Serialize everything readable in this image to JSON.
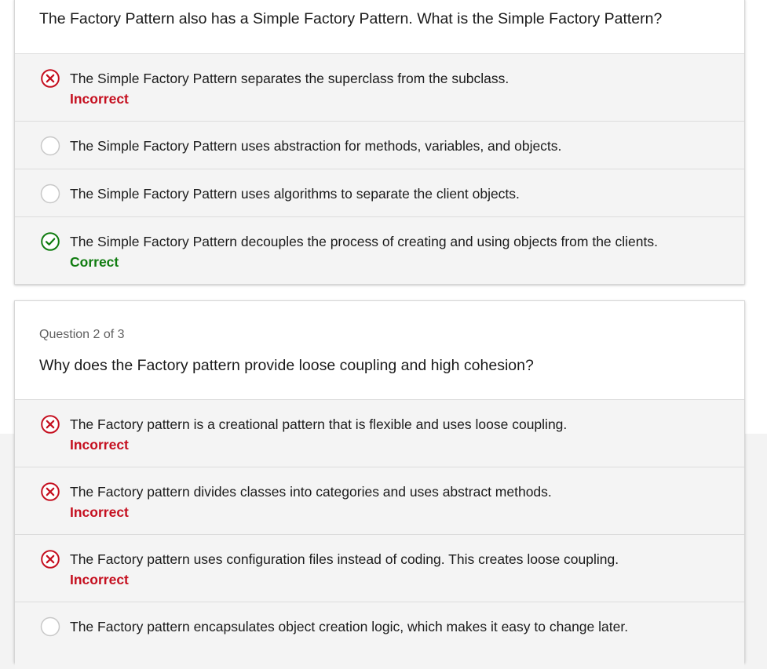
{
  "colors": {
    "incorrect": "#c50f1f",
    "correct": "#107c10",
    "radio_border": "#c8c8c8",
    "option_bg": "#f4f4f4"
  },
  "question1": {
    "text": "The Factory Pattern also has a Simple Factory Pattern. What is the Simple Factory Pattern?",
    "options": [
      {
        "text": "The Simple Factory Pattern separates the superclass from the subclass.",
        "state": "incorrect",
        "icon": "x-circle-icon",
        "status": "Incorrect"
      },
      {
        "text": "The Simple Factory Pattern uses abstraction for methods, variables, and objects.",
        "state": "unselected",
        "icon": "radio-empty-icon"
      },
      {
        "text": "The Simple Factory Pattern uses algorithms to separate the client objects.",
        "state": "unselected",
        "icon": "radio-empty-icon"
      },
      {
        "text": "The Simple Factory Pattern decouples the process of creating and using objects from the clients.",
        "state": "correct",
        "icon": "check-circle-icon",
        "status": "Correct"
      }
    ]
  },
  "question2": {
    "counter": "Question 2 of 3",
    "text": "Why does the Factory pattern provide loose coupling and high cohesion?",
    "options": [
      {
        "text": "The Factory pattern is a creational pattern that is flexible and uses loose coupling.",
        "state": "incorrect",
        "icon": "x-circle-icon",
        "status": "Incorrect"
      },
      {
        "text": "The Factory pattern divides classes into categories and uses abstract methods.",
        "state": "incorrect",
        "icon": "x-circle-icon",
        "status": "Incorrect"
      },
      {
        "text": "The Factory pattern uses configuration files instead of coding. This creates loose coupling.",
        "state": "incorrect",
        "icon": "x-circle-icon",
        "status": "Incorrect"
      },
      {
        "text": "The Factory pattern encapsulates object creation logic, which makes it easy to change later.",
        "state": "unselected",
        "icon": "radio-empty-icon"
      }
    ]
  }
}
